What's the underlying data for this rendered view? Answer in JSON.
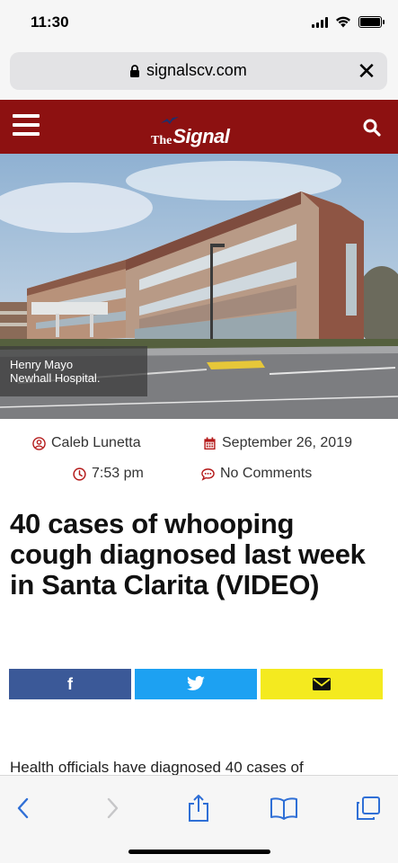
{
  "status_bar": {
    "time": "11:30"
  },
  "browser": {
    "url": "signalscv.com"
  },
  "site": {
    "logo_prefix": "The",
    "logo_name": "Signal",
    "brand_color": "#8d1111"
  },
  "hero": {
    "caption_line1": "Henry Mayo",
    "caption_line2": "Newhall Hospital."
  },
  "article": {
    "author": "Caleb Lunetta",
    "date": "September 26, 2019",
    "time": "7:53 pm",
    "comments": "No Comments",
    "title": "40 cases of whooping cough diagnosed last week in Santa Clarita (VIDEO)",
    "body_start": "Health officials have diagnosed 40 cases of"
  },
  "share": {
    "facebook_icon": "f",
    "colors": {
      "facebook": "#3b5998",
      "twitter": "#1da1f2",
      "email": "#f4ea1f"
    }
  },
  "icons": {
    "status": [
      "signal-icon",
      "wifi-icon",
      "battery-icon"
    ],
    "toolbar": [
      "back-icon",
      "forward-icon",
      "share-icon",
      "bookmarks-icon",
      "tabs-icon"
    ],
    "meta": [
      "user-icon",
      "calendar-icon",
      "clock-icon",
      "comment-icon"
    ]
  }
}
